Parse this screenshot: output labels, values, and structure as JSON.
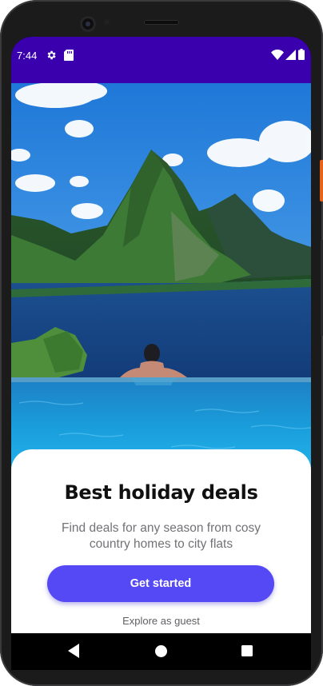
{
  "status_bar": {
    "time": "7:44",
    "background_color": "#3a00ae",
    "left_icons": [
      "settings-icon",
      "sd-card-icon"
    ],
    "right_icons": [
      "wifi-icon",
      "cell-signal-icon",
      "battery-icon"
    ]
  },
  "onboarding": {
    "title": "Best holiday deals",
    "subtitle": "Find deals for any season from cosy country homes to city flats",
    "primary_button_label": "Get started",
    "secondary_link_label": "Explore as guest",
    "accent_color": "#5548f5"
  },
  "nav_bar": {
    "buttons": [
      "back-icon",
      "home-icon",
      "recents-icon"
    ]
  }
}
